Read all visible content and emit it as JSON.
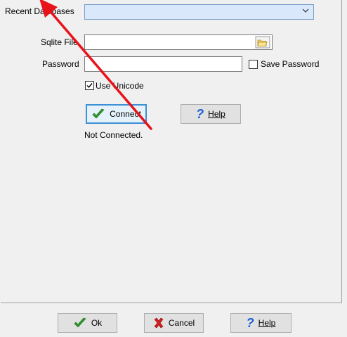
{
  "labels": {
    "recent_databases": "Recent Databases",
    "sqlite_file": "Sqlite File",
    "password": "Password"
  },
  "fields": {
    "recent_databases_value": "",
    "sqlite_file_value": "",
    "password_value": ""
  },
  "checkboxes": {
    "save_password": {
      "label": "Save Password",
      "checked": false
    },
    "use_unicode": {
      "label": "Use Unicode",
      "checked": true
    }
  },
  "buttons": {
    "connect": {
      "icon": "checkmark-icon",
      "label": "Connect"
    },
    "help_top": {
      "icon": "help-question-icon",
      "label": "Help",
      "mnemonic": "H"
    },
    "ok": {
      "icon": "checkmark-icon",
      "label": "Ok"
    },
    "cancel": {
      "icon": "red-x-icon",
      "label": "Cancel"
    },
    "help_bottom": {
      "icon": "help-question-icon",
      "label": "Help",
      "mnemonic": "H"
    }
  },
  "status": "Not Connected.",
  "colors": {
    "annotation_arrow": "#e8131a",
    "checkmark": "#2e9a2a",
    "cancel_x": "#d21e1e",
    "help_icon": "#1a5fd6",
    "combo_fill": "#dae8fc",
    "default_button_border": "#3d8fd6"
  }
}
